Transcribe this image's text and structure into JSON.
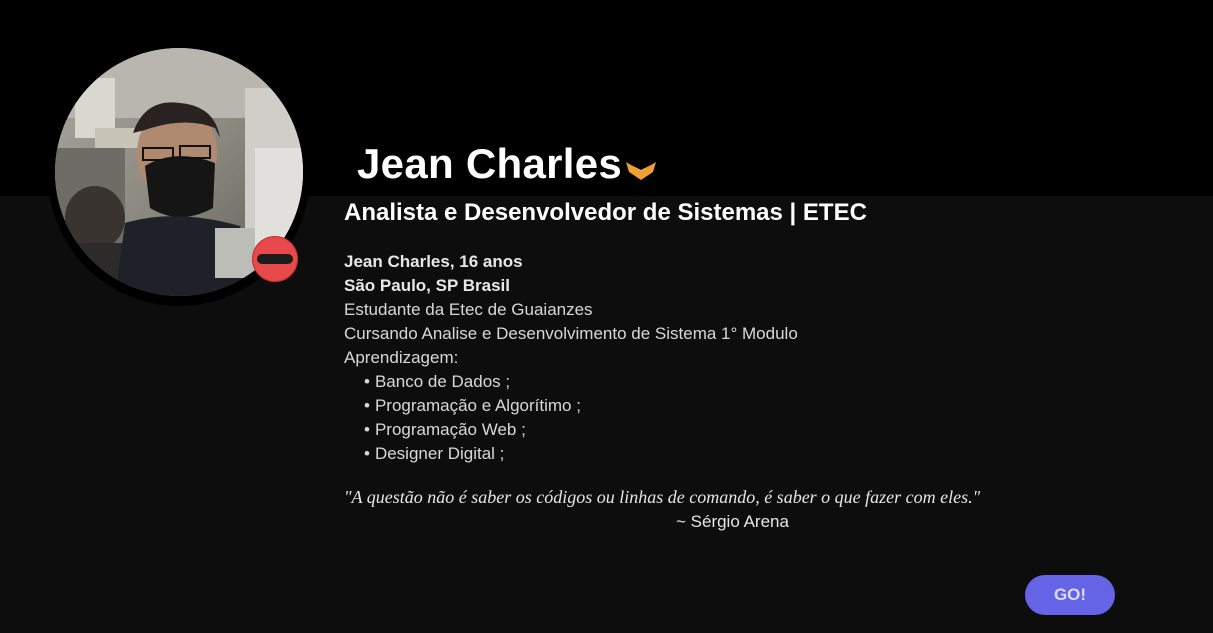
{
  "profile": {
    "name": "Jean Charles",
    "role": "Analista e Desenvolvedor de Sistemas | ETEC",
    "verified_icon": "chevron-badge-icon",
    "status_icon": "do-not-disturb-icon",
    "colors": {
      "badge": "#f0a030",
      "status": "#e8494a",
      "button": "#6563e6"
    }
  },
  "bio": {
    "age_line": "Jean Charles, 16 anos",
    "location_line": "São Paulo, SP Brasil",
    "school_line": "Estudante da Etec de Guaianzes",
    "course_line": "Cursando Analise e Desenvolvimento de Sistema 1° Modulo",
    "learning_label": "Aprendizagem:",
    "learning_items": [
      "Banco de Dados ;",
      "Programação e Algorítimo ;",
      "Programação Web ;",
      "Designer Digital ;"
    ]
  },
  "quote": {
    "text": "\"A questão não é saber os códigos ou linhas de comando, é saber o que fazer com eles.\"",
    "author": "~ Sérgio Arena"
  },
  "actions": {
    "go_label": "GO!"
  }
}
